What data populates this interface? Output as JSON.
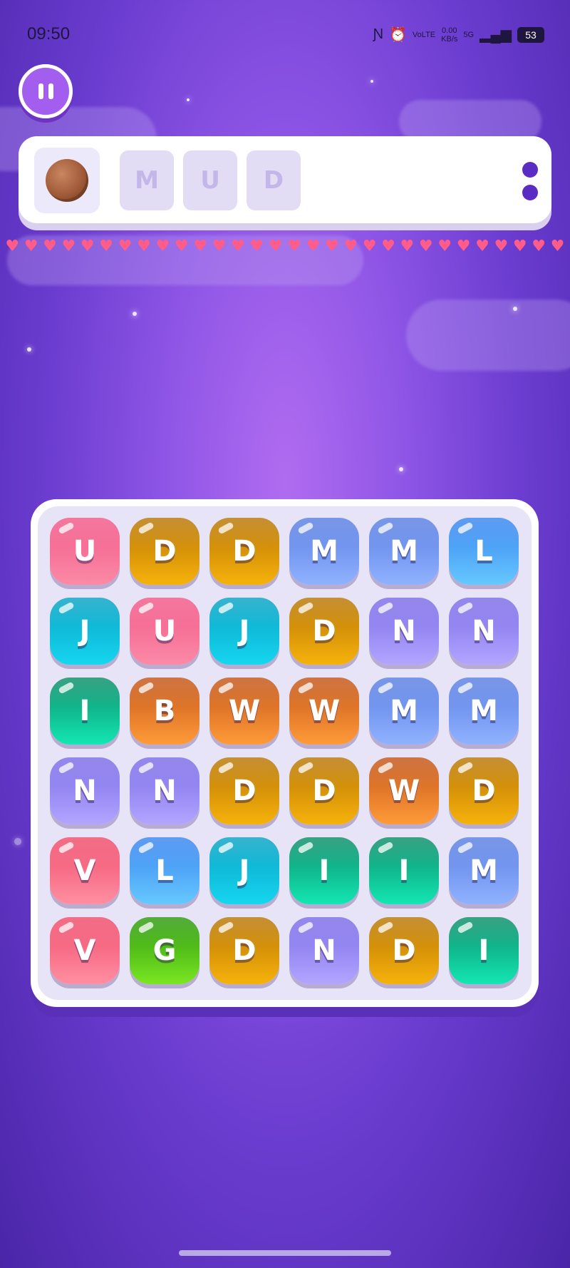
{
  "status_bar": {
    "time": "09:50",
    "network_label": "VoLTE",
    "data_speed": "0.00",
    "data_unit": "KB/s",
    "signal": "5G",
    "battery": "53",
    "icons": [
      "nfc-icon",
      "alarm-icon",
      "signal-icon"
    ]
  },
  "pause_button": {
    "icon": "pause-icon"
  },
  "word_panel": {
    "coin_icon": "bronze-coin",
    "target_letters": [
      "M",
      "U",
      "D"
    ],
    "menu_icon": "two-dots-icon"
  },
  "hearts": {
    "count": 30,
    "glyph": "♥",
    "color": "#ff5c8a"
  },
  "board": {
    "rows": 6,
    "cols": 6,
    "tiles": [
      [
        {
          "letter": "U",
          "color": "pink"
        },
        {
          "letter": "D",
          "color": "amber"
        },
        {
          "letter": "D",
          "color": "amber"
        },
        {
          "letter": "M",
          "color": "blue"
        },
        {
          "letter": "M",
          "color": "blue"
        },
        {
          "letter": "L",
          "color": "sky"
        }
      ],
      [
        {
          "letter": "J",
          "color": "cyan"
        },
        {
          "letter": "U",
          "color": "pink"
        },
        {
          "letter": "J",
          "color": "cyan"
        },
        {
          "letter": "D",
          "color": "amber"
        },
        {
          "letter": "N",
          "color": "violet"
        },
        {
          "letter": "N",
          "color": "violet"
        }
      ],
      [
        {
          "letter": "I",
          "color": "teal"
        },
        {
          "letter": "B",
          "color": "orange"
        },
        {
          "letter": "W",
          "color": "orange"
        },
        {
          "letter": "W",
          "color": "orange"
        },
        {
          "letter": "M",
          "color": "blue"
        },
        {
          "letter": "M",
          "color": "blue"
        }
      ],
      [
        {
          "letter": "N",
          "color": "violet"
        },
        {
          "letter": "N",
          "color": "violet"
        },
        {
          "letter": "D",
          "color": "amber"
        },
        {
          "letter": "D",
          "color": "amber"
        },
        {
          "letter": "W",
          "color": "orange"
        },
        {
          "letter": "D",
          "color": "amber"
        }
      ],
      [
        {
          "letter": "V",
          "color": "red"
        },
        {
          "letter": "L",
          "color": "sky"
        },
        {
          "letter": "J",
          "color": "cyan"
        },
        {
          "letter": "I",
          "color": "teal"
        },
        {
          "letter": "I",
          "color": "teal"
        },
        {
          "letter": "M",
          "color": "blue"
        }
      ],
      [
        {
          "letter": "V",
          "color": "red"
        },
        {
          "letter": "G",
          "color": "green"
        },
        {
          "letter": "D",
          "color": "amber"
        },
        {
          "letter": "N",
          "color": "violet"
        },
        {
          "letter": "D",
          "color": "amber"
        },
        {
          "letter": "I",
          "color": "teal"
        }
      ]
    ]
  },
  "colors": {
    "background_top": "#4a25a8",
    "background_center": "#b06cf0",
    "panel": "#ffffff",
    "menu_dots": "#5a2cc4",
    "pause_button": "#a35ef0"
  }
}
